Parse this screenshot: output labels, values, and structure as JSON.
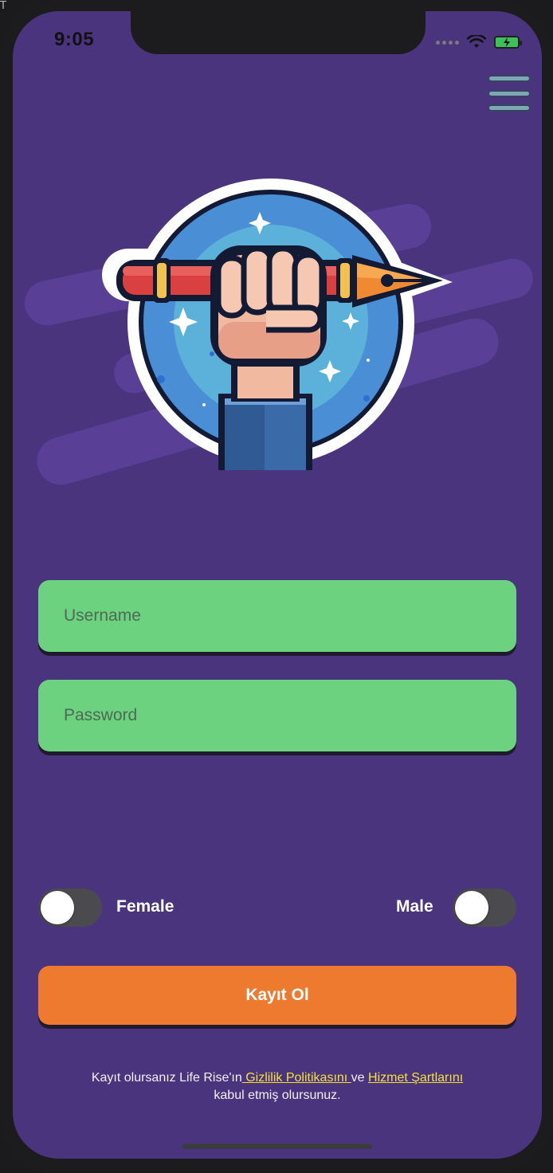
{
  "status_bar": {
    "time": "9:05"
  },
  "form": {
    "username_placeholder": "Username",
    "password_placeholder": "Password"
  },
  "gender": {
    "female_label": "Female",
    "male_label": "Male",
    "female_selected": false,
    "male_selected": false
  },
  "register_button_label": "Kayıt Ol",
  "terms": {
    "prefix": "Kayıt olursanız Life Rise'ın",
    "privacy_link": " Gizlilik Politikasını ",
    "conjunction": " ve ",
    "terms_link": "Hizmet Şartlarını",
    "suffix": "kabul etmiş olursunuz."
  },
  "colors": {
    "background": "#4a347d",
    "input_fill": "#6dd27f",
    "button_fill": "#ee7a2f",
    "link": "#f5e03a",
    "toggle_off": "#4a4a4f"
  },
  "icons": [
    "menu-icon",
    "wifi-icon",
    "battery-charging-icon",
    "fist-pen-logo"
  ]
}
